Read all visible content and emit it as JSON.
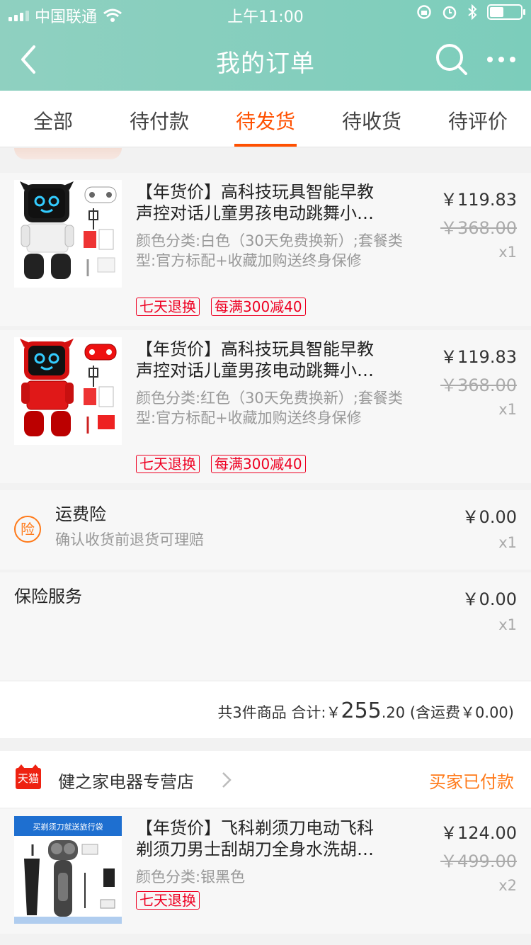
{
  "status_bar": {
    "carrier": "中国联通",
    "time": "上午11:00",
    "battery_level": 0.45
  },
  "nav": {
    "title": "我的订单"
  },
  "tabs": [
    {
      "label": "全部"
    },
    {
      "label": "待付款"
    },
    {
      "label": "待发货",
      "active": true
    },
    {
      "label": "待收货"
    },
    {
      "label": "待评价"
    }
  ],
  "order1": {
    "items": [
      {
        "name_line1": "【年货价】高科技玩具智能早教",
        "name_line2": "声控对话儿童男孩电动跳舞小…",
        "sku": "颜色分类:白色（30天免费换新）;套餐类型:官方标配+收藏加购送终身保修",
        "tags": [
          "七天退换",
          "每满300减40"
        ],
        "price": "￥119.83",
        "original_price": "￥368.00",
        "qty": "x1",
        "color": "white"
      },
      {
        "name_line1": "【年货价】高科技玩具智能早教",
        "name_line2": "声控对话儿童男孩电动跳舞小…",
        "sku": "颜色分类:红色（30天免费换新）;套餐类型:官方标配+收藏加购送终身保修",
        "tags": [
          "七天退换",
          "每满300减40"
        ],
        "price": "￥119.83",
        "original_price": "￥368.00",
        "qty": "x1",
        "color": "red"
      }
    ],
    "freight_insurance": {
      "badge": "险",
      "title": "运费险",
      "desc": "确认收货前退货可理赔",
      "price": "￥0.00",
      "qty": "x1"
    },
    "insurance_service": {
      "title": "保险服务",
      "price": "￥0.00",
      "qty": "x1"
    },
    "summary": {
      "count_text": "共3件商品",
      "total_label": "合计:",
      "currency": "￥",
      "total_int": "255",
      "total_dec": ".20",
      "shipping": "(含运费￥0.00)"
    }
  },
  "order2": {
    "store": {
      "logo_text": "天猫",
      "name": "健之家电器专营店",
      "status": "买家已付款"
    },
    "item": {
      "banner": "买剃须刀就送旅行袋",
      "name_line1": "【年货价】飞科剃须刀电动飞科",
      "name_line2": "剃须刀男士刮胡刀全身水洗胡…",
      "sku": "颜色分类:银黑色",
      "tags": [
        "七天退换"
      ],
      "price": "￥124.00",
      "original_price": "￥499.00",
      "qty": "x2"
    }
  },
  "colors": {
    "accent": "#ff5000",
    "header": "#7ccdbb",
    "tag": "#e02222",
    "status_orange": "#ff7a1a"
  }
}
